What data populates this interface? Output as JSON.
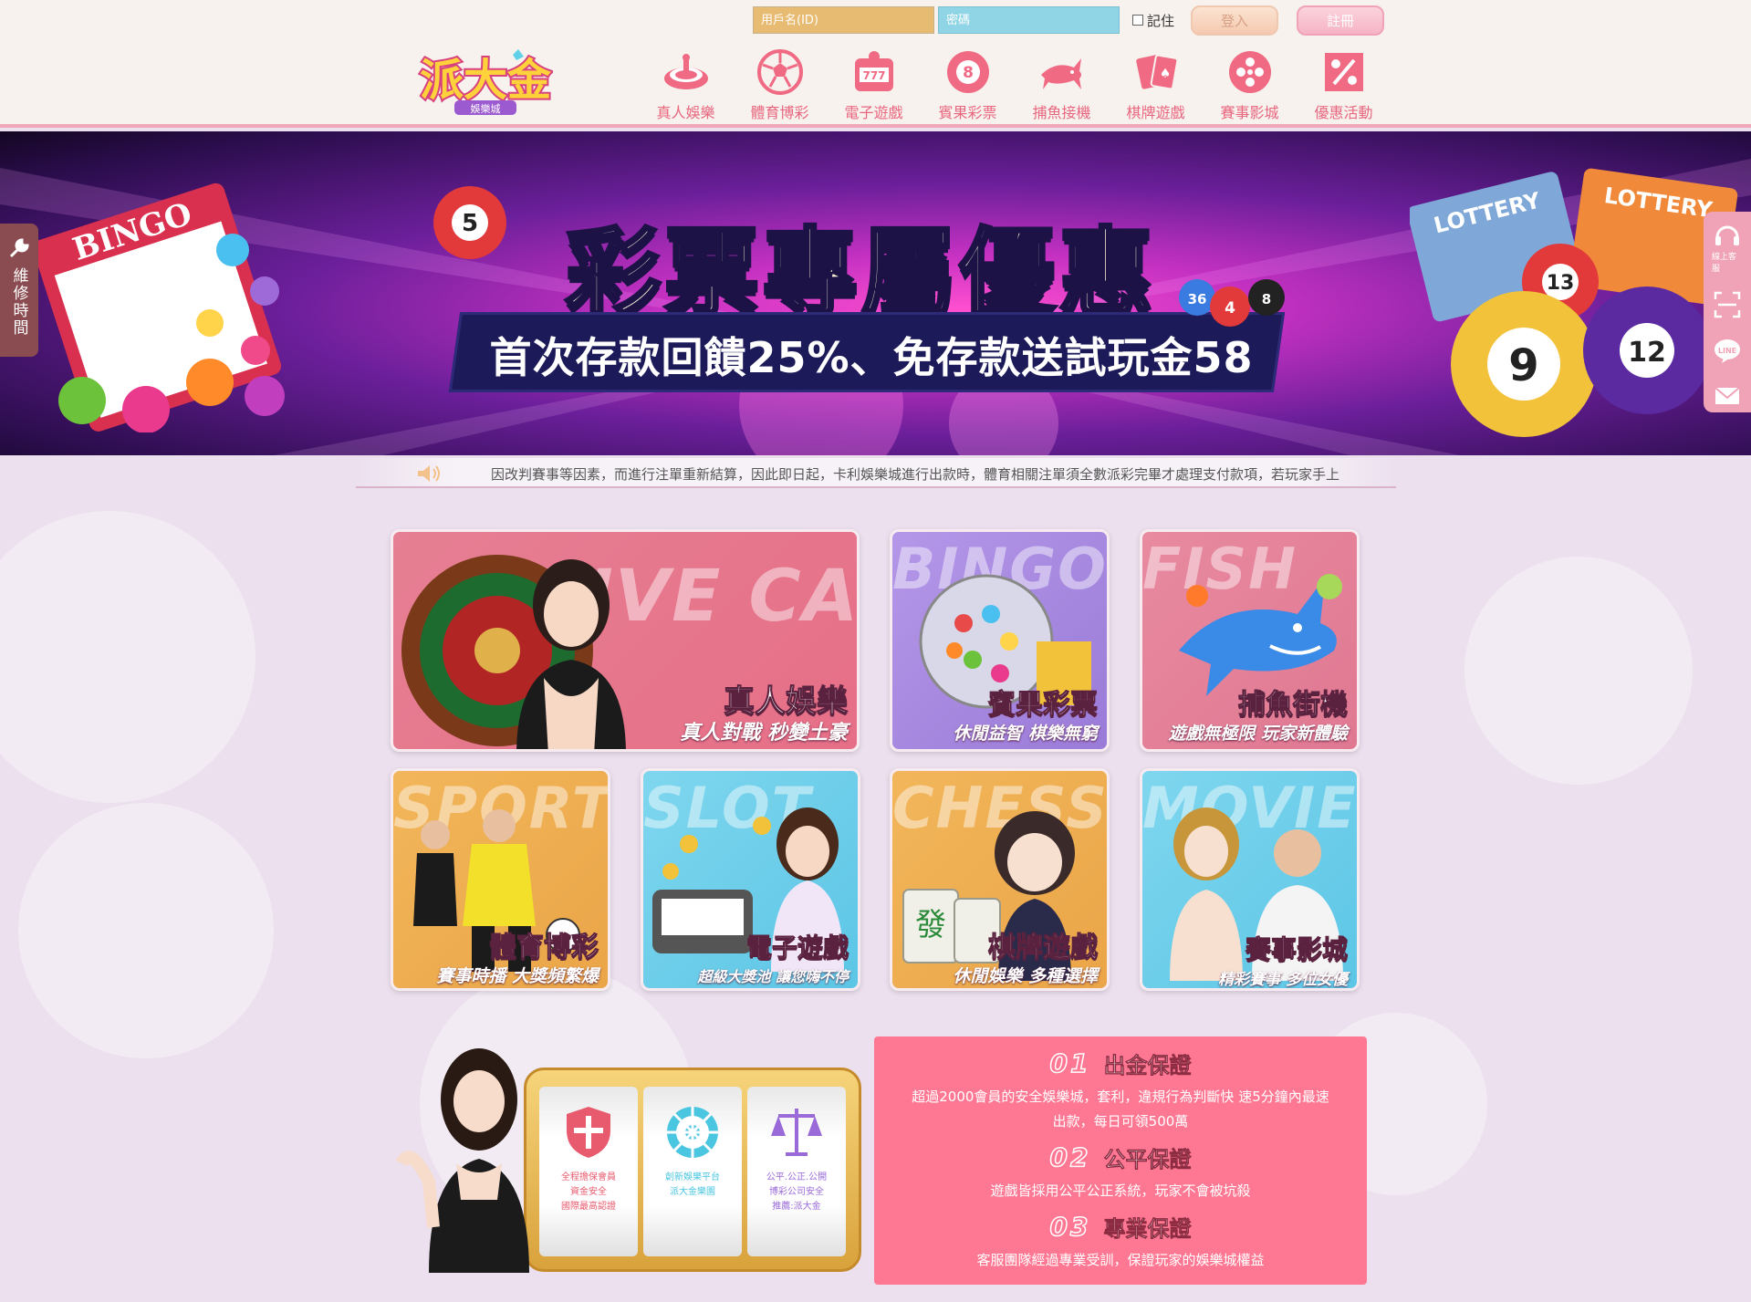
{
  "header": {
    "username_placeholder": "用戶名(ID)",
    "password_placeholder": "密碼",
    "remember_label": "記住",
    "login_label": "登入",
    "register_label": "註冊",
    "logo_text": "派大金",
    "logo_sub": "娛樂城",
    "nav": [
      {
        "label": "真人娛樂",
        "icon": "roulette-icon"
      },
      {
        "label": "體育博彩",
        "icon": "soccer-ball-icon"
      },
      {
        "label": "電子遊戲",
        "icon": "slot-machine-icon"
      },
      {
        "label": "賓果彩票",
        "icon": "lottery-ball-icon"
      },
      {
        "label": "捕魚接機",
        "icon": "shark-icon"
      },
      {
        "label": "棋牌遊戲",
        "icon": "playing-cards-icon"
      },
      {
        "label": "賽事影城",
        "icon": "film-reel-icon"
      },
      {
        "label": "優惠活動",
        "icon": "percent-icon"
      }
    ]
  },
  "banner": {
    "title": "彩票專屬優惠",
    "subtitle": "首次存款回饋25%、免存款送試玩金58",
    "bingo_label": "BINGO",
    "lottery_label": "LOTTERY",
    "balls": [
      "5",
      "13",
      "9",
      "12",
      "36",
      "4",
      "8"
    ]
  },
  "side_left": {
    "label": "維修時間"
  },
  "side_right": {
    "items": [
      {
        "label": "線上客服"
      },
      {
        "label": ""
      },
      {
        "label": "LINE"
      },
      {
        "label": ""
      }
    ]
  },
  "marquee": {
    "text": "因改判賽事等因素，而進行注單重新結算，因此即日起，卡利娛樂城進行出款時，體育相關注單須全數派彩完畢才處理支付款項，若玩家手上"
  },
  "cards": [
    {
      "watermark": "LIVE CASINO",
      "title": "真人娛樂",
      "subtitle": "真人對戰 秒變土豪"
    },
    {
      "watermark": "BINGO",
      "title": "賓果彩票",
      "subtitle": "休閒益智 棋樂無窮"
    },
    {
      "watermark": "FISH",
      "title": "捕魚街機",
      "subtitle": "遊戲無極限 玩家新體驗"
    },
    {
      "watermark": "SPORT",
      "title": "體育博彩",
      "subtitle": "賽事時播 大獎頻繁爆"
    },
    {
      "watermark": "SLOT",
      "title": "電子遊戲",
      "subtitle": "超級大獎池 讓您嗨不停"
    },
    {
      "watermark": "CHESS",
      "title": "棋牌遊戲",
      "subtitle": "休閒娛樂 多種選擇"
    },
    {
      "watermark": "MOVIE",
      "title": "賽事影城",
      "subtitle": "精彩賽事 多位女優"
    }
  ],
  "slot_reels": [
    {
      "icon": "shield-icon",
      "lines": [
        "全程擔保會員",
        "資金安全",
        "國際最高認證"
      ]
    },
    {
      "icon": "wheel-icon",
      "lines": [
        "創新娛樂平台",
        "派大金樂園"
      ]
    },
    {
      "icon": "scale-icon",
      "lines": [
        "公平.公正.公開",
        "博彩公司安全",
        "推薦:派大金"
      ]
    }
  ],
  "guarantees": [
    {
      "num": "01",
      "title": "出金保證",
      "desc": "超過2000會員的安全娛樂城，套利，違規行為判斷快 速5分鐘內最速出款，每日可領500萬"
    },
    {
      "num": "02",
      "title": "公平保證",
      "desc": "遊戲皆採用公平公正系統，玩家不會被坑殺"
    },
    {
      "num": "03",
      "title": "專業保證",
      "desc": "客服團隊經過專業受訓，保證玩家的娛樂城權益"
    }
  ],
  "colors": {
    "accent": "#e8677f",
    "guarantee_bg": "#ff7893",
    "page_bg": "#ece0ee"
  }
}
